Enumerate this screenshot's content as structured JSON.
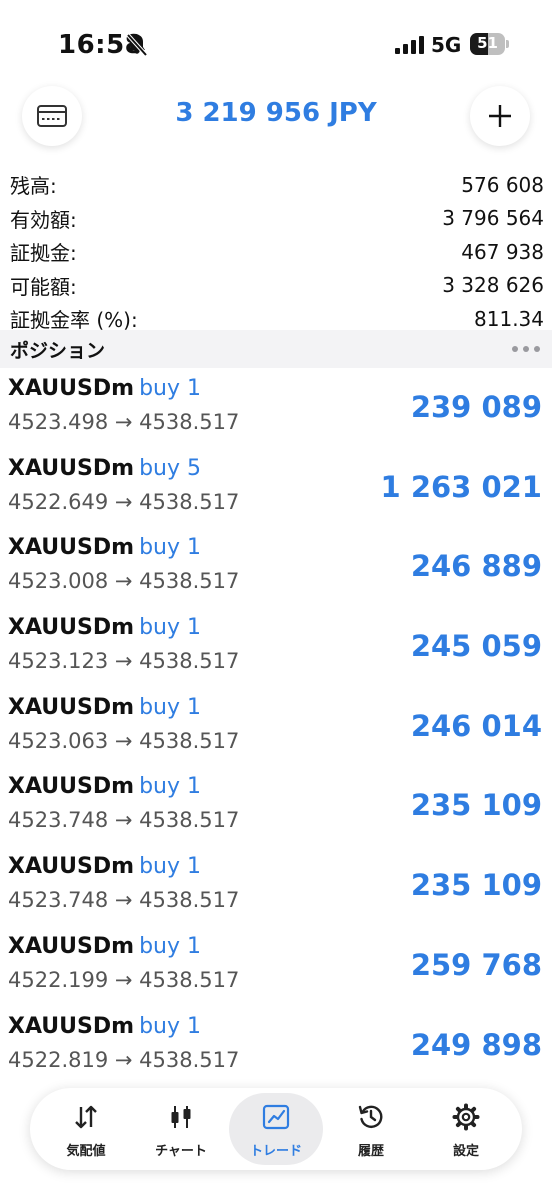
{
  "status_bar": {
    "time": "16:58",
    "network": "5G",
    "battery": "51"
  },
  "header": {
    "balance": "3 219 956 JPY"
  },
  "summary": [
    {
      "label": "残高:",
      "value": "576 608"
    },
    {
      "label": "有効額:",
      "value": "3 796 564"
    },
    {
      "label": "証拠金:",
      "value": "467 938"
    },
    {
      "label": "可能額:",
      "value": "3 328 626"
    },
    {
      "label": "証拠金率 (%):",
      "value": "811.34"
    }
  ],
  "positions_section": {
    "title": "ポジション"
  },
  "positions": [
    {
      "symbol": "XAUUSDm",
      "side": "buy 1",
      "prices": "4523.498 → 4538.517",
      "profit": "239 089"
    },
    {
      "symbol": "XAUUSDm",
      "side": "buy 5",
      "prices": "4522.649 → 4538.517",
      "profit": "1 263 021"
    },
    {
      "symbol": "XAUUSDm",
      "side": "buy 1",
      "prices": "4523.008 → 4538.517",
      "profit": "246 889"
    },
    {
      "symbol": "XAUUSDm",
      "side": "buy 1",
      "prices": "4523.123 → 4538.517",
      "profit": "245 059"
    },
    {
      "symbol": "XAUUSDm",
      "side": "buy 1",
      "prices": "4523.063 → 4538.517",
      "profit": "246 014"
    },
    {
      "symbol": "XAUUSDm",
      "side": "buy 1",
      "prices": "4523.748 → 4538.517",
      "profit": "235 109"
    },
    {
      "symbol": "XAUUSDm",
      "side": "buy 1",
      "prices": "4523.748 → 4538.517",
      "profit": "235 109"
    },
    {
      "symbol": "XAUUSDm",
      "side": "buy 1",
      "prices": "4522.199 → 4538.517",
      "profit": "259 768"
    },
    {
      "symbol": "XAUUSDm",
      "side": "buy 1",
      "prices": "4522.819 → 4538.517",
      "profit": "249 898"
    }
  ],
  "nav": {
    "items": [
      {
        "label": "気配値",
        "icon": "quotes-arrows-icon"
      },
      {
        "label": "チャート",
        "icon": "candlestick-chart-icon"
      },
      {
        "label": "トレード",
        "icon": "trade-chart-icon",
        "active": true
      },
      {
        "label": "履歴",
        "icon": "history-icon"
      },
      {
        "label": "設定",
        "icon": "settings-gear-icon"
      }
    ]
  },
  "colors": {
    "accent": "#2f7de1",
    "text": "#111111",
    "section_bg": "#f3f3f5",
    "nav_active_bg": "#ebebed"
  }
}
